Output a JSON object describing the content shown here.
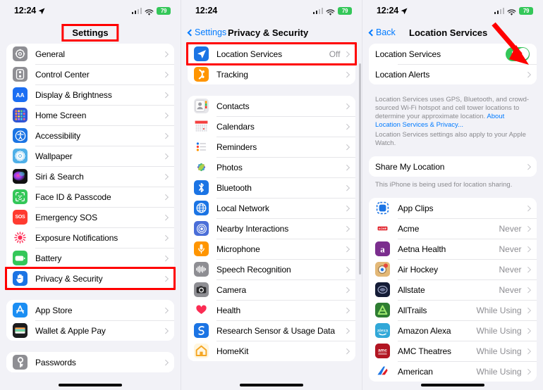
{
  "status_bar": {
    "time": "12:24",
    "battery": "79",
    "wifi_icon": "wifi-icon",
    "signal_icon": "cellular-signal-icon",
    "location_arrow_icon": "location-arrow-icon"
  },
  "panel_settings": {
    "title": "Settings",
    "highlighted": true,
    "groups": [
      {
        "items": [
          {
            "label": "General",
            "icon": "gear-icon",
            "color": "#8e8e93"
          },
          {
            "label": "Control Center",
            "icon": "control-center-icon",
            "color": "#8e8e93"
          },
          {
            "label": "Display & Brightness",
            "icon": "display-brightness-icon",
            "color": "#1b6ef3"
          },
          {
            "label": "Home Screen",
            "icon": "home-screen-icon",
            "color": "#2f55d4"
          },
          {
            "label": "Accessibility",
            "icon": "accessibility-icon",
            "color": "#1b74e4"
          },
          {
            "label": "Wallpaper",
            "icon": "wallpaper-icon",
            "color": "#4fb0e8"
          },
          {
            "label": "Siri & Search",
            "icon": "siri-icon",
            "color": "#1c1c1e"
          },
          {
            "label": "Face ID & Passcode",
            "icon": "face-id-icon",
            "color": "#34c759"
          },
          {
            "label": "Emergency SOS",
            "icon": "sos-icon",
            "color": "#ff3b30"
          },
          {
            "label": "Exposure Notifications",
            "icon": "exposure-notifications-icon",
            "color": "#ffffff"
          },
          {
            "label": "Battery",
            "icon": "battery-icon",
            "color": "#34c759"
          },
          {
            "label": "Privacy & Security",
            "icon": "privacy-hand-icon",
            "color": "#1b74e4",
            "highlighted": true
          }
        ]
      },
      {
        "items": [
          {
            "label": "App Store",
            "icon": "app-store-icon",
            "color": "#1b8ef3"
          },
          {
            "label": "Wallet & Apple Pay",
            "icon": "wallet-icon",
            "color": "#1c1c1e"
          }
        ]
      },
      {
        "items": [
          {
            "label": "Passwords",
            "icon": "passwords-key-icon",
            "color": "#8e8e93"
          }
        ]
      }
    ]
  },
  "panel_privacy": {
    "back_label": "Settings",
    "title": "Privacy & Security",
    "groups": [
      {
        "items": [
          {
            "label": "Location Services",
            "value": "Off",
            "icon": "location-services-icon",
            "color": "#1b74e4",
            "highlighted": true
          },
          {
            "label": "Tracking",
            "icon": "tracking-icon",
            "color": "#ff9500"
          }
        ]
      },
      {
        "items": [
          {
            "label": "Contacts",
            "icon": "contacts-icon",
            "color": "#d8d8de"
          },
          {
            "label": "Calendars",
            "icon": "calendars-icon",
            "color": "#ffffff"
          },
          {
            "label": "Reminders",
            "icon": "reminders-icon",
            "color": "#ffffff"
          },
          {
            "label": "Photos",
            "icon": "photos-icon",
            "color": "#ffffff"
          },
          {
            "label": "Bluetooth",
            "icon": "bluetooth-icon",
            "color": "#1b74e4"
          },
          {
            "label": "Local Network",
            "icon": "local-network-icon",
            "color": "#1b74e4"
          },
          {
            "label": "Nearby Interactions",
            "icon": "nearby-interactions-icon",
            "color": "#4a6ed8"
          },
          {
            "label": "Microphone",
            "icon": "microphone-icon",
            "color": "#ff9500"
          },
          {
            "label": "Speech Recognition",
            "icon": "speech-recognition-icon",
            "color": "#8e8e93"
          },
          {
            "label": "Camera",
            "icon": "camera-icon",
            "color": "#8e8e93"
          },
          {
            "label": "Health",
            "icon": "health-icon",
            "color": "#ffffff"
          },
          {
            "label": "Research Sensor & Usage Data",
            "icon": "research-sensor-icon",
            "color": "#1b74e4"
          },
          {
            "label": "HomeKit",
            "icon": "homekit-icon",
            "color": "#fff3d6"
          }
        ]
      }
    ]
  },
  "panel_location": {
    "back_label": "Back",
    "title": "Location Services",
    "toggle_row": {
      "label": "Location Services",
      "state": "on",
      "toggle_color": "#34c759"
    },
    "alerts_row": {
      "label": "Location Alerts"
    },
    "footnote_1": "Location Services uses GPS, Bluetooth, and crowd-sourced Wi-Fi hotspot and cell tower locations to determine your approximate location. ",
    "footnote_1_link": "About Location Services & Privacy...",
    "footnote_2": "Location Services settings also apply to your Apple Watch.",
    "share_row": {
      "label": "Share My Location"
    },
    "share_footnote": "This iPhone is being used for location sharing.",
    "apps": [
      {
        "label": "App Clips",
        "value": "",
        "icon": "app-clips-icon",
        "color": "#ffffff"
      },
      {
        "label": "Acme",
        "value": "Never",
        "icon": "acme-icon",
        "color": "#ffffff"
      },
      {
        "label": "Aetna Health",
        "value": "Never",
        "icon": "aetna-health-icon",
        "color": "#7b2e8e"
      },
      {
        "label": "Air Hockey",
        "value": "Never",
        "icon": "air-hockey-icon",
        "color": "#e8c48a"
      },
      {
        "label": "Allstate",
        "value": "Never",
        "icon": "allstate-icon",
        "color": "#131b33"
      },
      {
        "label": "AllTrails",
        "value": "While Using",
        "icon": "alltrails-icon",
        "color": "#2f7d32"
      },
      {
        "label": "Amazon Alexa",
        "value": "While Using",
        "icon": "amazon-alexa-icon",
        "color": "#31a8d8"
      },
      {
        "label": "AMC Theatres",
        "value": "While Using",
        "icon": "amc-theatres-icon",
        "color": "#b21522"
      },
      {
        "label": "American",
        "value": "While Using",
        "icon": "american-airlines-icon",
        "color": "#ffffff"
      }
    ]
  },
  "annotations": {
    "highlight_color": "#ff0000",
    "arrow_color": "#ff0000"
  }
}
